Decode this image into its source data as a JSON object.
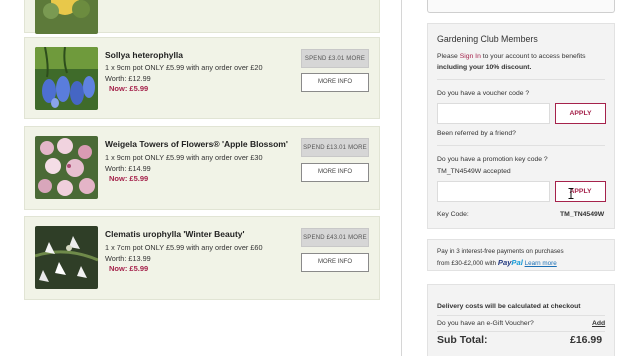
{
  "products": [
    {
      "name": "Sollya heterophylla",
      "offer": "1 x 9cm pot ONLY £5.99 with any order over £20",
      "worth": "Worth: £12.99",
      "now": "Now: £5.99",
      "spend_label": "SPEND £3.01 MORE",
      "more_label": "MORE INFO",
      "image_icon": "blue-bell-flower-photo"
    },
    {
      "name": "Weigela Towers of Flowers® 'Apple Blossom'",
      "offer": "1 x 9cm pot ONLY £5.99 with any order over £30",
      "worth": "Worth: £14.99",
      "now": "Now: £5.99",
      "spend_label": "SPEND £13.01 MORE",
      "more_label": "MORE INFO",
      "image_icon": "pink-blossom-photo"
    },
    {
      "name": "Clematis urophylla 'Winter Beauty'",
      "offer": "1 x 7cm pot ONLY £5.99 with any order over £60",
      "worth": "Worth: £13.99",
      "now": "Now: £5.99",
      "spend_label": "SPEND £43.01 MORE",
      "more_label": "MORE INFO",
      "image_icon": "white-clematis-photo"
    }
  ],
  "club": {
    "title": "Gardening Club Members",
    "line1_pre": "Please",
    "line1_link": "Sign In",
    "line1_post": "to your account to access benefits",
    "line2": "including your 10% discount."
  },
  "voucher": {
    "label": "Do you have a voucher code ?",
    "value": "",
    "apply_label": "APPLY",
    "referred_link": "Been referred by a friend?"
  },
  "promo": {
    "label": "Do you have a promotion key code ?",
    "accepted": "TM_TN4549W accepted",
    "value": "",
    "apply_label": "APPLY",
    "key_code_label": "Key Code:",
    "key_code_value": "TM_TN4549W"
  },
  "paypal_box": {
    "line1": "Pay in 3 interest-free payments on purchases",
    "line2_pre": "from £30-£2,000 with",
    "brand_part1": "Pay",
    "brand_part2": "Pal",
    "learn_more": "Learn more"
  },
  "summary": {
    "delivery_note": "Delivery costs will be calculated at checkout",
    "egift_label": "Do you have an e-Gift Voucher?",
    "egift_link": "Add",
    "subtotal_label": "Sub Total:",
    "subtotal_value": "£16.99"
  },
  "colors": {
    "accent": "#a5224b",
    "card_bg": "#f1f3e7",
    "panel_bg": "#f3f3f3",
    "paypal_dark": "#253b80",
    "paypal_light": "#179bd7"
  }
}
